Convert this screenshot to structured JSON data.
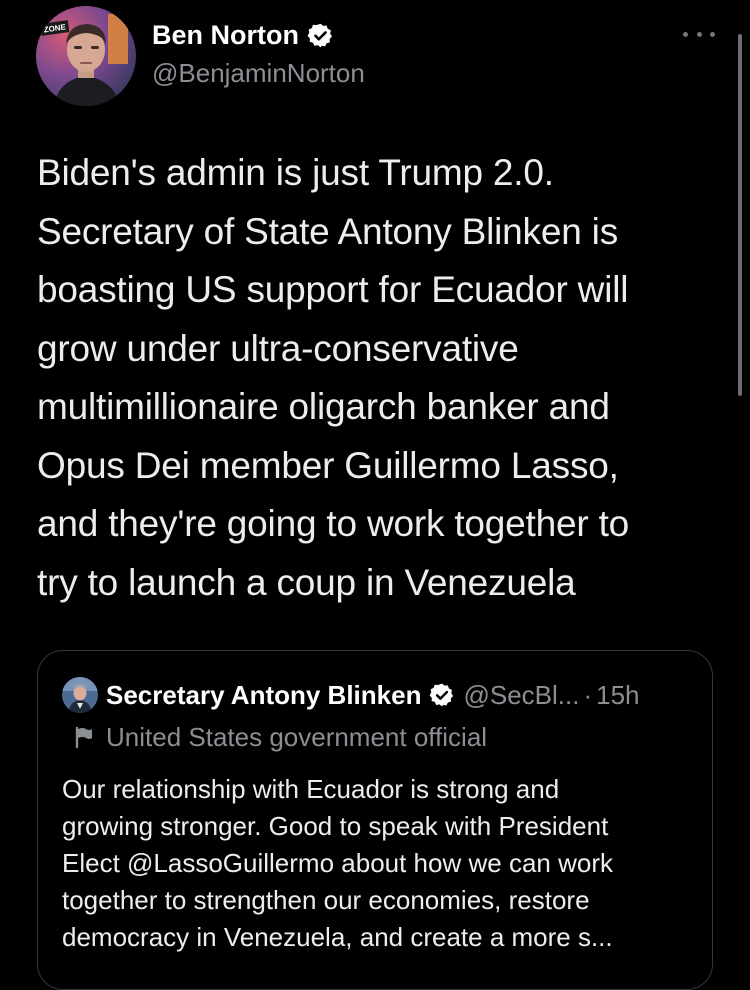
{
  "tweet": {
    "author_name": "Ben Norton",
    "author_handle": "@BenjaminNorton",
    "avatar_badge": "ZONE",
    "text_lines": [
      "Biden's admin is just Trump 2.0.",
      "Secretary of State Antony Blinken is",
      "boasting US support for Ecuador will",
      "grow under ultra-conservative",
      "multimillionaire oligarch banker and",
      "Opus Dei member Guillermo Lasso,",
      "and they're going to work together to",
      "try to launch a coup in Venezuela"
    ],
    "icons": {
      "verified": "verified-badge-icon",
      "more": "more-options-icon"
    }
  },
  "quoted_tweet": {
    "author_name": "Secretary Antony Blinken",
    "author_handle": "@SecBl...",
    "separator": "·",
    "time": "15h",
    "label": "United States government official",
    "text_lines": [
      "Our relationship with Ecuador is strong and",
      "growing stronger. Good to speak with President",
      "Elect @LassoGuillermo about how we can work",
      "together to strengthen our economies, restore",
      "democracy in Venezuela, and create a more s..."
    ],
    "icons": {
      "verified": "verified-badge-icon",
      "label": "flag-icon"
    }
  },
  "colors": {
    "background": "#000000",
    "primary_text": "#e7e9ea",
    "secondary_text": "#8b8f94",
    "card_border": "#34373b"
  }
}
